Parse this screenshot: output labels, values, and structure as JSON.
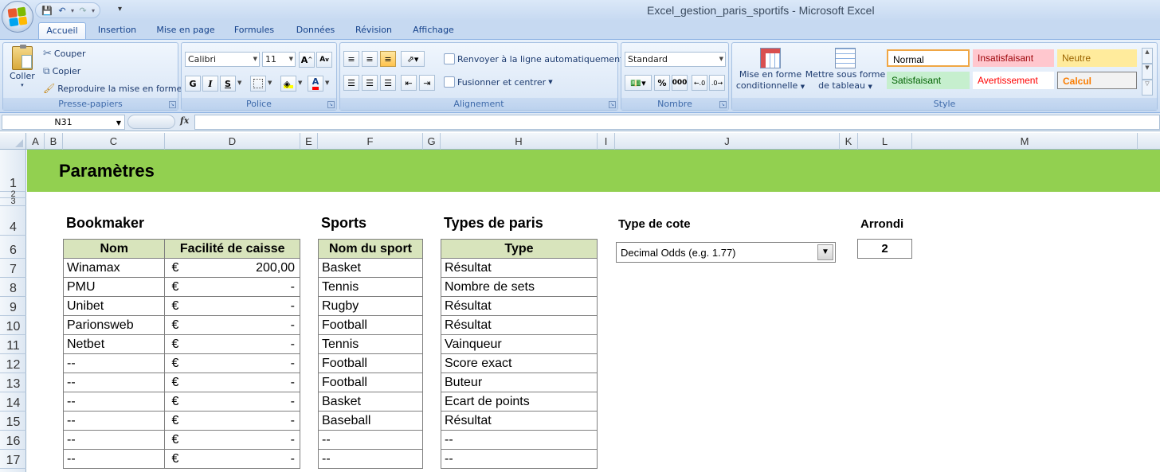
{
  "window": {
    "title": "Excel_gestion_paris_sportifs - Microsoft Excel"
  },
  "tabs": [
    "Accueil",
    "Insertion",
    "Mise en page",
    "Formules",
    "Données",
    "Révision",
    "Affichage"
  ],
  "ribbon": {
    "clipboard": {
      "label": "Presse-papiers",
      "paste": "Coller",
      "cut": "Couper",
      "copy": "Copier",
      "format_painter": "Reproduire la mise en forme"
    },
    "font": {
      "label": "Police",
      "family": "Calibri",
      "size": "11",
      "bold": "G",
      "italic": "I",
      "underline": "S"
    },
    "alignment": {
      "label": "Alignement",
      "wrap": "Renvoyer à la ligne automatiquement",
      "merge": "Fusionner et centrer"
    },
    "number": {
      "label": "Nombre",
      "format": "Standard",
      "percent": "%",
      "thousands": "000"
    },
    "styles": {
      "label": "Style",
      "conditional": [
        "Mise en forme",
        "conditionnelle"
      ],
      "as_table": [
        "Mettre sous forme",
        "de tableau"
      ],
      "cells": [
        {
          "name": "Normal",
          "bg": "#ffffff",
          "fg": "#000000"
        },
        {
          "name": "Insatisfaisant",
          "bg": "#ffc7ce",
          "fg": "#9c0006"
        },
        {
          "name": "Neutre",
          "bg": "#ffeb9c",
          "fg": "#9c6500"
        },
        {
          "name": "Satisfaisant",
          "bg": "#c6efce",
          "fg": "#006100"
        },
        {
          "name": "Avertissement",
          "bg": "#ffffff",
          "fg": "#ff0000"
        },
        {
          "name": "Calcul",
          "bg": "#f2f2f2",
          "fg": "#fa7d00"
        }
      ]
    }
  },
  "formula_bar": {
    "name_box": "N31",
    "fx": "fx",
    "value": ""
  },
  "columns": [
    "A",
    "B",
    "C",
    "D",
    "E",
    "F",
    "G",
    "H",
    "I",
    "J",
    "K",
    "L",
    "M"
  ],
  "rows": [
    "1",
    "2",
    "3",
    "4",
    "6",
    "7",
    "8",
    "9",
    "10",
    "11",
    "12",
    "13",
    "14",
    "15",
    "16",
    "17"
  ],
  "sheet": {
    "banner_title": "Paramètres",
    "bookmaker": {
      "title": "Bookmaker",
      "headers": [
        "Nom",
        "Facilité de caisse"
      ],
      "rows": [
        [
          "Winamax",
          "€",
          "200,00"
        ],
        [
          "PMU",
          "€",
          "-"
        ],
        [
          "Unibet",
          "€",
          "-"
        ],
        [
          "Parionsweb",
          "€",
          "-"
        ],
        [
          "Netbet",
          "€",
          "-"
        ],
        [
          "--",
          "€",
          "-"
        ],
        [
          "--",
          "€",
          "-"
        ],
        [
          "--",
          "€",
          "-"
        ],
        [
          "--",
          "€",
          "-"
        ],
        [
          "--",
          "€",
          "-"
        ],
        [
          "--",
          "€",
          "-"
        ]
      ]
    },
    "sports": {
      "title": "Sports",
      "header": "Nom du sport",
      "rows": [
        "Basket",
        "Tennis",
        "Rugby",
        "Football",
        "Tennis",
        "Football",
        "Football",
        "Basket",
        "Baseball",
        "--",
        "--"
      ]
    },
    "bet_types": {
      "title": "Types de paris",
      "header": "Type",
      "rows": [
        "Résultat",
        "Nombre de sets",
        "Résultat",
        "Résultat",
        "Vainqueur",
        "Score exact",
        "Buteur",
        "Ecart de points",
        "Résultat",
        "--",
        "--"
      ]
    },
    "odds_type": {
      "label": "Type de cote",
      "value": "Decimal Odds (e.g. 1.77)"
    },
    "rounding": {
      "label": "Arrondi",
      "value": "2"
    }
  }
}
